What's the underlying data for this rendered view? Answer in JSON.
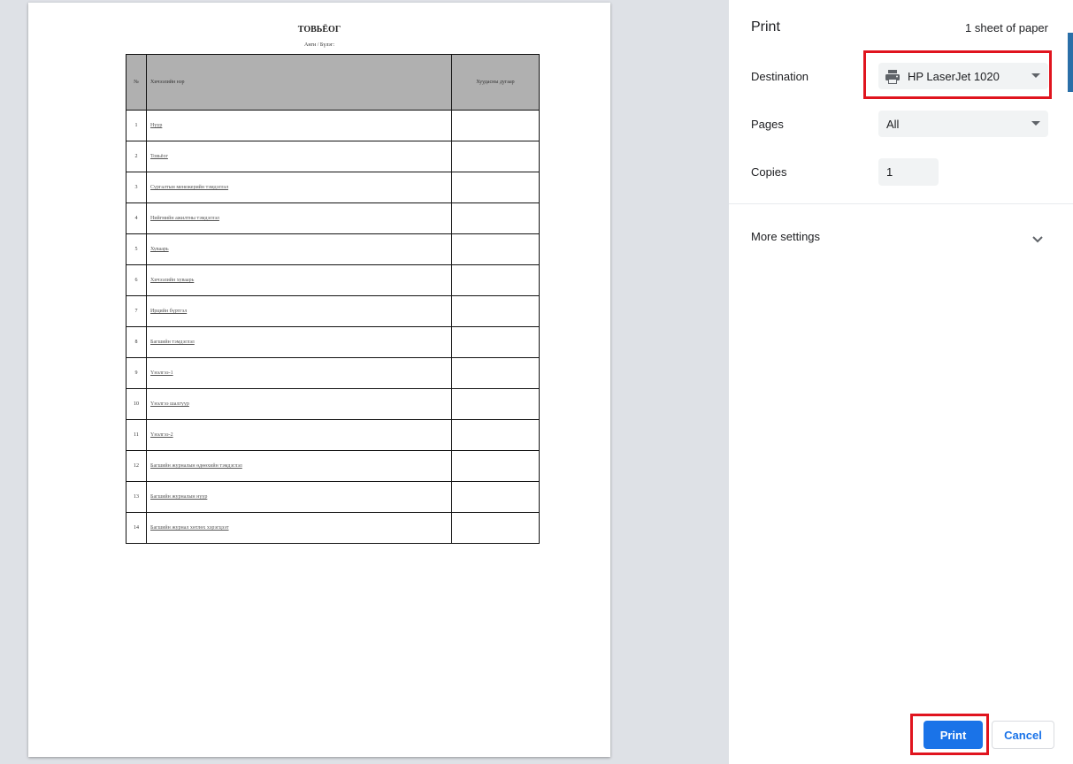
{
  "document": {
    "title": "ТОВЬЁОГ",
    "subtitle": "Анги / Бүлэг:",
    "table": {
      "headers": [
        "№",
        "Хичээлийн нэр",
        "Хуудасны дугаар"
      ],
      "rows": [
        {
          "num": "1",
          "name": "Нүүр"
        },
        {
          "num": "2",
          "name": "Товьёог"
        },
        {
          "num": "3",
          "name": "Сургалтын менежерийн тэмдэглэл"
        },
        {
          "num": "4",
          "name": "Нийгмийн ажилтны тэмдэглэл"
        },
        {
          "num": "5",
          "name": "Хуваарь"
        },
        {
          "num": "6",
          "name": "Хичээлийн хуваарь"
        },
        {
          "num": "7",
          "name": "Ирцийн бүртгэл"
        },
        {
          "num": "8",
          "name": "Багшийн тэмдэглэл"
        },
        {
          "num": "9",
          "name": "Үнэлгээ-1"
        },
        {
          "num": "10",
          "name": "Үнэлгээ шалгуур"
        },
        {
          "num": "11",
          "name": "Үнэлгээ-2"
        },
        {
          "num": "12",
          "name": "Багшийн журналын өдөөхийн тэмдэглэл"
        },
        {
          "num": "13",
          "name": "Багшийн журналын нүүр"
        },
        {
          "num": "14",
          "name": "Багшийн журнал хөтлөх хэрэгцээт"
        }
      ]
    }
  },
  "panel": {
    "title": "Print",
    "sheet_count": "1 sheet of paper",
    "destination_label": "Destination",
    "destination_value": "HP LaserJet 1020",
    "pages_label": "Pages",
    "pages_value": "All",
    "copies_label": "Copies",
    "copies_value": "1",
    "more_settings_label": "More settings",
    "print_label": "Print",
    "cancel_label": "Cancel"
  },
  "colors": {
    "accent": "#1a73e8",
    "highlight": "#e0141e",
    "table_header": "#b0b0b0"
  },
  "icons": [
    "printer-icon",
    "chevron-down-icon"
  ]
}
